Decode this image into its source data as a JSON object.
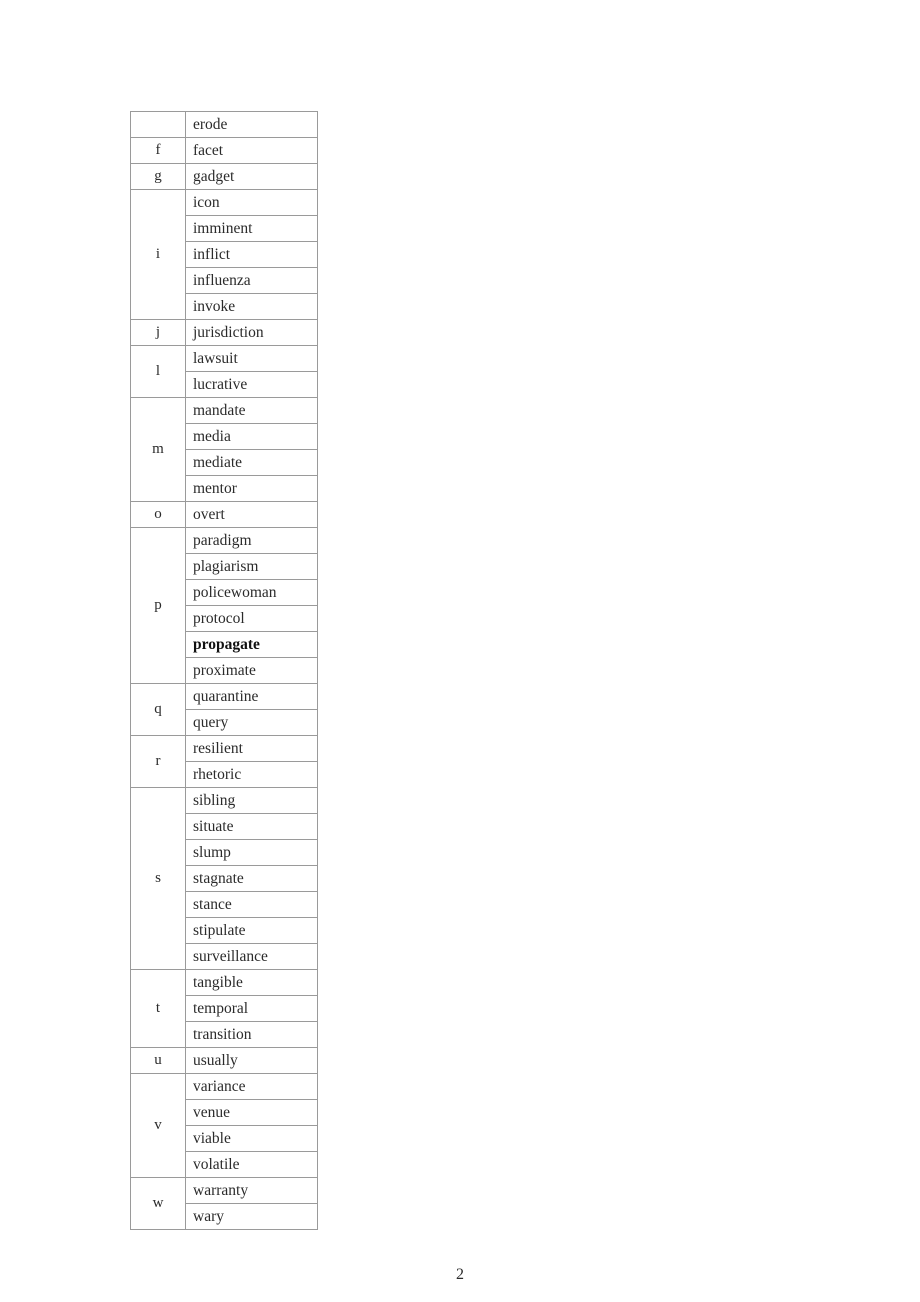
{
  "document": {
    "page_number": "2",
    "table": {
      "columns": [
        "letter",
        "word"
      ],
      "groups": [
        {
          "letter": "",
          "words": [
            {
              "text": "erode",
              "bold": false
            }
          ]
        },
        {
          "letter": "f",
          "words": [
            {
              "text": "facet",
              "bold": false
            }
          ]
        },
        {
          "letter": "g",
          "words": [
            {
              "text": "gadget",
              "bold": false
            }
          ]
        },
        {
          "letter": "i",
          "words": [
            {
              "text": "icon",
              "bold": false
            },
            {
              "text": "imminent",
              "bold": false
            },
            {
              "text": "inflict",
              "bold": false
            },
            {
              "text": "influenza",
              "bold": false
            },
            {
              "text": "invoke",
              "bold": false
            }
          ]
        },
        {
          "letter": "j",
          "words": [
            {
              "text": "jurisdiction",
              "bold": false
            }
          ]
        },
        {
          "letter": "l",
          "words": [
            {
              "text": "lawsuit",
              "bold": false
            },
            {
              "text": "lucrative",
              "bold": false
            }
          ]
        },
        {
          "letter": "m",
          "words": [
            {
              "text": "mandate",
              "bold": false
            },
            {
              "text": "media",
              "bold": false
            },
            {
              "text": "mediate",
              "bold": false
            },
            {
              "text": "mentor",
              "bold": false
            }
          ]
        },
        {
          "letter": "o",
          "words": [
            {
              "text": "overt",
              "bold": false
            }
          ]
        },
        {
          "letter": "p",
          "words": [
            {
              "text": "paradigm",
              "bold": false
            },
            {
              "text": "plagiarism",
              "bold": false
            },
            {
              "text": "policewoman",
              "bold": false
            },
            {
              "text": "protocol",
              "bold": false
            },
            {
              "text": "propagate",
              "bold": true
            },
            {
              "text": "proximate",
              "bold": false
            }
          ]
        },
        {
          "letter": "q",
          "words": [
            {
              "text": "quarantine",
              "bold": false
            },
            {
              "text": "query",
              "bold": false
            }
          ]
        },
        {
          "letter": "r",
          "words": [
            {
              "text": "resilient",
              "bold": false
            },
            {
              "text": "rhetoric",
              "bold": false
            }
          ]
        },
        {
          "letter": "s",
          "words": [
            {
              "text": "sibling",
              "bold": false
            },
            {
              "text": "situate",
              "bold": false
            },
            {
              "text": "slump",
              "bold": false
            },
            {
              "text": "stagnate",
              "bold": false
            },
            {
              "text": "stance",
              "bold": false
            },
            {
              "text": "stipulate",
              "bold": false
            },
            {
              "text": "surveillance",
              "bold": false
            }
          ]
        },
        {
          "letter": "t",
          "words": [
            {
              "text": "tangible",
              "bold": false
            },
            {
              "text": "temporal",
              "bold": false
            },
            {
              "text": "transition",
              "bold": false
            }
          ]
        },
        {
          "letter": "u",
          "words": [
            {
              "text": "usually",
              "bold": false
            }
          ]
        },
        {
          "letter": "v",
          "words": [
            {
              "text": "variance",
              "bold": false
            },
            {
              "text": "venue",
              "bold": false
            },
            {
              "text": "viable",
              "bold": false
            },
            {
              "text": "volatile",
              "bold": false
            }
          ]
        },
        {
          "letter": "w",
          "words": [
            {
              "text": "warranty",
              "bold": false
            },
            {
              "text": "wary",
              "bold": false
            }
          ]
        }
      ]
    }
  }
}
